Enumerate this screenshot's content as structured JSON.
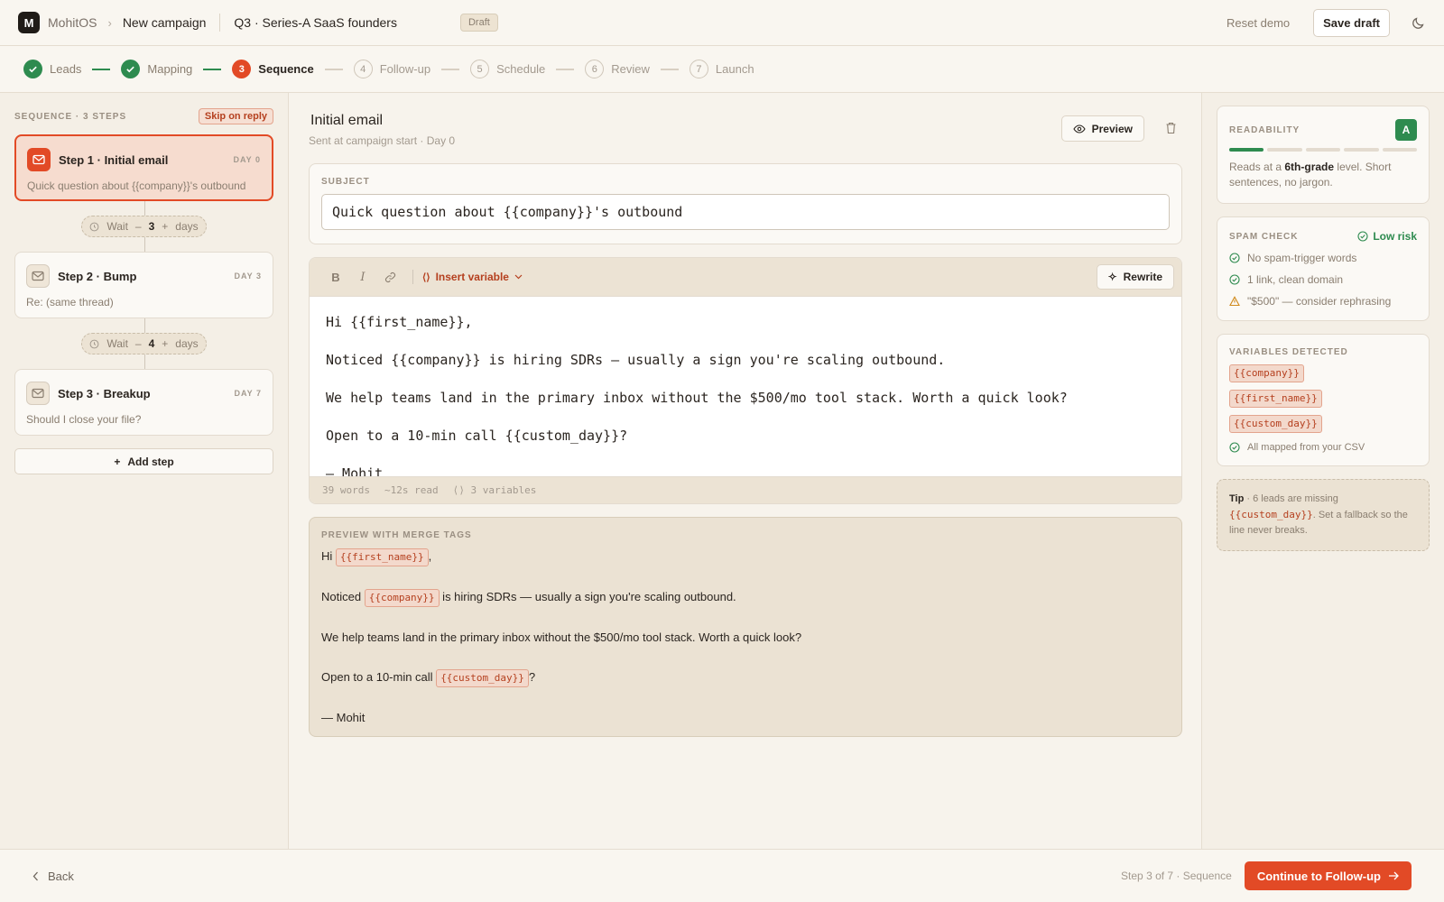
{
  "app": {
    "logo_letter": "M",
    "brand": "MohitOS",
    "breadcrumb_current": "New campaign",
    "campaign_name": "Q3 · Series-A SaaS founders",
    "status_badge": "Draft"
  },
  "topbar": {
    "reset_label": "Reset demo",
    "save_label": "Save draft"
  },
  "stepper": [
    {
      "num": "1",
      "label": "Leads",
      "state": "done"
    },
    {
      "num": "2",
      "label": "Mapping",
      "state": "done"
    },
    {
      "num": "3",
      "label": "Sequence",
      "state": "active"
    },
    {
      "num": "4",
      "label": "Follow-up",
      "state": "todo"
    },
    {
      "num": "5",
      "label": "Schedule",
      "state": "todo"
    },
    {
      "num": "6",
      "label": "Review",
      "state": "todo"
    },
    {
      "num": "7",
      "label": "Launch",
      "state": "todo"
    }
  ],
  "sidebar": {
    "title": "SEQUENCE · 3 STEPS",
    "skip_badge": "Skip on reply",
    "steps": [
      {
        "title": "Step 1 · Initial email",
        "day": "DAY 0",
        "subtitle": "Quick question about {{company}}'s outbound"
      },
      {
        "title": "Step 2 · Bump",
        "day": "DAY 3",
        "subtitle": "Re: (same thread)"
      },
      {
        "title": "Step 3 · Breakup",
        "day": "DAY 7",
        "subtitle": "Should I close your file?"
      }
    ],
    "waits": [
      {
        "label": "Wait",
        "minus": "–",
        "value": "3",
        "plus": "+",
        "unit": "days"
      },
      {
        "label": "Wait",
        "minus": "–",
        "value": "4",
        "plus": "+",
        "unit": "days"
      }
    ],
    "add_step_label": "Add step"
  },
  "main": {
    "title": "Initial email",
    "subtitle": "Sent at campaign start · Day 0",
    "preview_label": "Preview",
    "subject_label": "SUBJECT",
    "subject_value": "Quick question about {{company}}'s outbound",
    "toolbar": {
      "bold": "B",
      "italic": "I",
      "insert_variable": "Insert variable",
      "rewrite": "Rewrite"
    },
    "body_lines": [
      "Hi {{first_name}},",
      "Noticed {{company}} is hiring SDRs — usually a sign you're scaling outbound.",
      "We help teams land in the primary inbox without the $500/mo tool stack. Worth a quick look?",
      "Open to a 10-min call {{custom_day}}?",
      "— Mohit"
    ],
    "footer": {
      "words": "39 words",
      "read": "~12s read",
      "vars": "3 variables"
    },
    "merge": {
      "label": "PREVIEW WITH MERGE TAGS",
      "l1_pre": "Hi ",
      "l1_tag": "{{first_name}}",
      "l1_post": ",",
      "l2_pre": "Noticed ",
      "l2_tag": "{{company}}",
      "l2_post": " is hiring SDRs — usually a sign you're scaling outbound.",
      "l3": "We help teams land in the primary inbox without the $500/mo tool stack. Worth a quick look?",
      "l4_pre": "Open to a 10-min call ",
      "l4_tag": "{{custom_day}}",
      "l4_post": "?",
      "l5": "— Mohit"
    }
  },
  "right": {
    "readability": {
      "label": "READABILITY",
      "grade": "A",
      "level_fraction": 0.2,
      "text_pre": "Reads at a ",
      "text_bold": "6th-grade",
      "text_post": " level. Short sentences, no jargon."
    },
    "spam": {
      "label": "SPAM CHECK",
      "risk": "Low risk",
      "items": [
        {
          "icon": "check",
          "text": "No spam-trigger words"
        },
        {
          "icon": "check",
          "text": "1 link, clean domain"
        },
        {
          "icon": "warning",
          "text": "\"$500\" — consider rephrasing"
        }
      ]
    },
    "variables": {
      "label": "VARIABLES DETECTED",
      "items": [
        "{{company}}",
        "{{first_name}}",
        "{{custom_day}}"
      ],
      "note": "All mapped from your CSV"
    },
    "tip": {
      "bold": "Tip",
      "pre": " · 6 leads are missing ",
      "var": "{{custom_day}}",
      "post": ". Set a fallback so the line never breaks."
    }
  },
  "footer": {
    "back_label": "Back",
    "status": "Step 3 of 7 · Sequence",
    "continue_label": "Continue to Follow-up"
  },
  "colors": {
    "accent": "#e24a26",
    "success": "#2e8b4f",
    "background": "#f7f3ec"
  }
}
